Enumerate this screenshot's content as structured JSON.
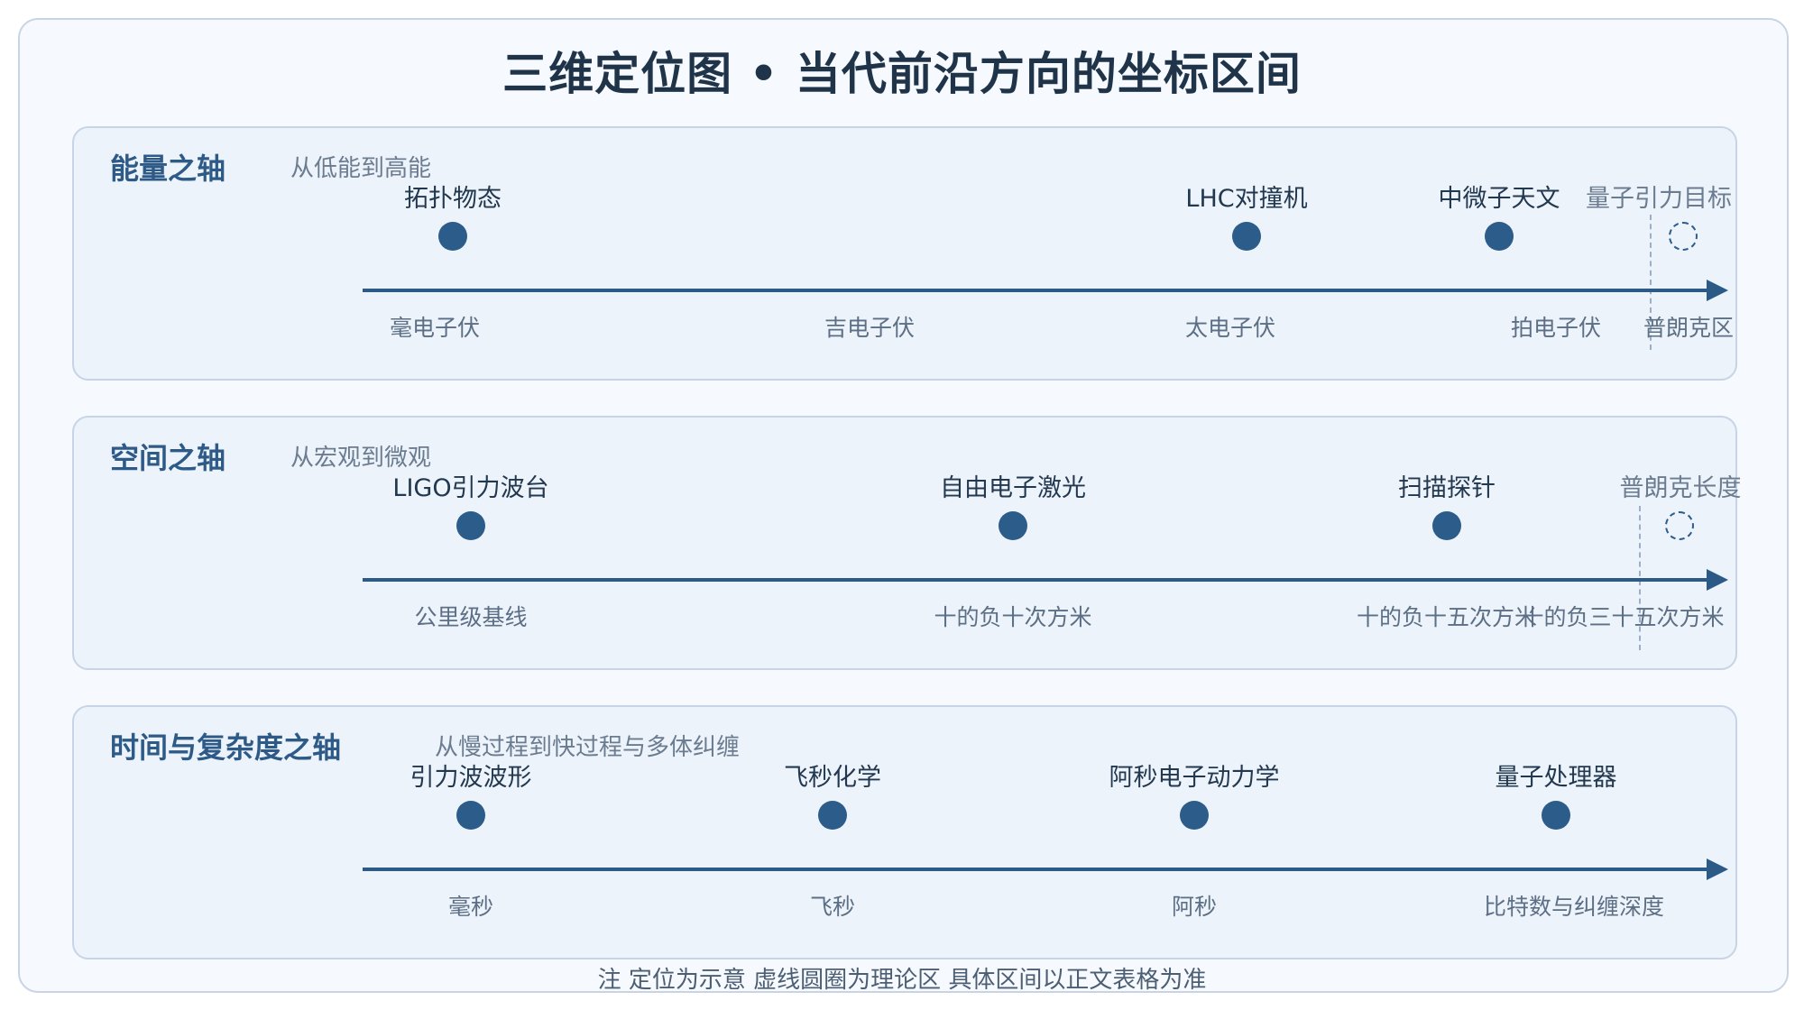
{
  "title": "三维定位图 • 当代前沿方向的坐标区间",
  "note": "注 定位为示意 虚线圆圈为理论区 具体区间以正文表格为准",
  "colors": {
    "axis": "#2b5a86",
    "dot": "#2c5c89",
    "panel_bg": "#edf3fb",
    "panel_border": "#c7d4e6",
    "title": "#1f3349",
    "panel_title": "#2d5a87"
  },
  "panels": [
    {
      "title": "能量之轴",
      "subtitle": "从低能到高能",
      "points": [
        {
          "label": "拓扑物态",
          "theory": false
        },
        {
          "label": "LHC对撞机",
          "theory": false
        },
        {
          "label": "中微子天文",
          "theory": false
        },
        {
          "label": "量子引力目标",
          "theory": true
        }
      ],
      "ticks": [
        "毫电子伏",
        "吉电子伏",
        "太电子伏",
        "拍电子伏",
        "普朗克区"
      ]
    },
    {
      "title": "空间之轴",
      "subtitle": "从宏观到微观",
      "points": [
        {
          "label": "LIGO引力波台",
          "theory": false
        },
        {
          "label": "自由电子激光",
          "theory": false
        },
        {
          "label": "扫描探针",
          "theory": false
        },
        {
          "label": "普朗克长度",
          "theory": true
        }
      ],
      "ticks": [
        "公里级基线",
        "十的负十次方米",
        "十的负十五次方米",
        "十的负三十五次方米"
      ]
    },
    {
      "title": "时间与复杂度之轴",
      "subtitle": "从慢过程到快过程与多体纠缠",
      "points": [
        {
          "label": "引力波波形",
          "theory": false
        },
        {
          "label": "飞秒化学",
          "theory": false
        },
        {
          "label": "阿秒电子动力学",
          "theory": false
        },
        {
          "label": "量子处理器",
          "theory": false
        }
      ],
      "ticks": [
        "毫秒",
        "飞秒",
        "阿秒",
        "比特数与纠缠深度"
      ]
    }
  ]
}
